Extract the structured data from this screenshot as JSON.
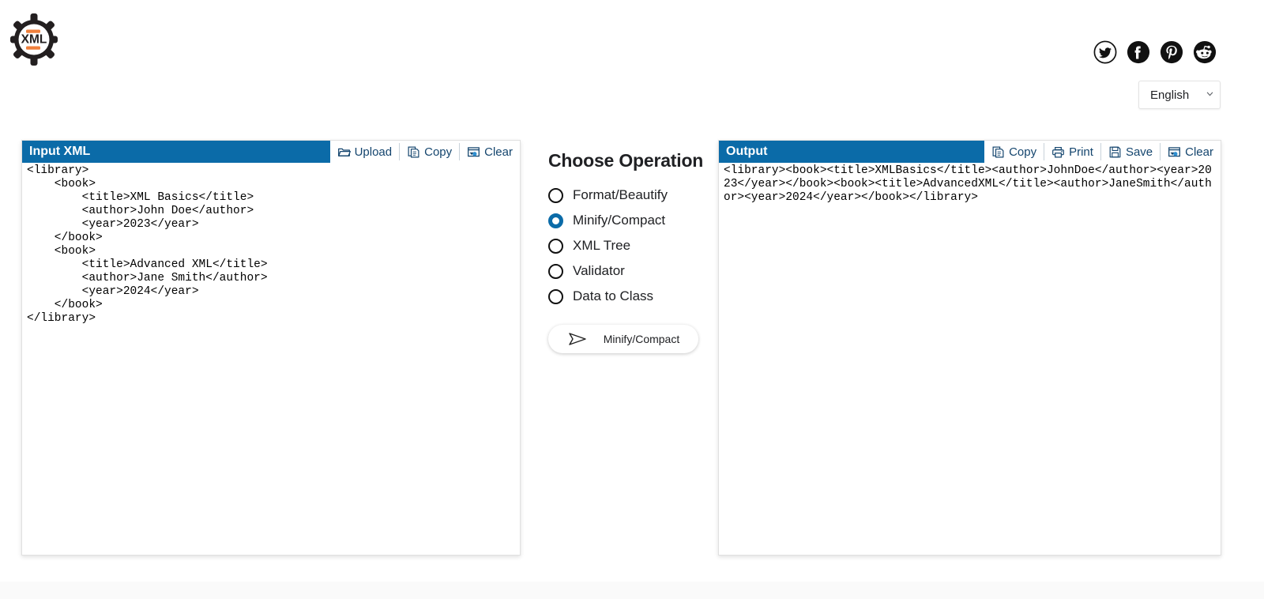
{
  "header": {
    "logo_text": "XML",
    "social": [
      {
        "name": "twitter-icon",
        "label": "Twitter"
      },
      {
        "name": "facebook-icon",
        "label": "Facebook"
      },
      {
        "name": "pinterest-icon",
        "label": "Pinterest"
      },
      {
        "name": "reddit-icon",
        "label": "Reddit"
      }
    ],
    "language": {
      "selected": "English",
      "options": [
        "English"
      ]
    }
  },
  "input_panel": {
    "title": "Input XML",
    "tools": [
      {
        "label": "Upload",
        "icon": "folder-icon"
      },
      {
        "label": "Copy",
        "icon": "copy-icon"
      },
      {
        "label": "Clear",
        "icon": "clear-icon"
      }
    ],
    "value": "<library>\n    <book>\n        <title>XML Basics</title>\n        <author>John Doe</author>\n        <year>2023</year>\n    </book>\n    <book>\n        <title>Advanced XML</title>\n        <author>Jane Smith</author>\n        <year>2024</year>\n    </book>\n</library>",
    "placeholder": ""
  },
  "output_panel": {
    "title": "Output",
    "tools": [
      {
        "label": "Copy",
        "icon": "copy-icon"
      },
      {
        "label": "Print",
        "icon": "print-icon"
      },
      {
        "label": "Save",
        "icon": "save-icon"
      },
      {
        "label": "Clear",
        "icon": "clear-icon"
      }
    ],
    "value": "<library><book><title>XMLBasics</title><author>JohnDoe</author><year>2023</year></book><book><title>AdvancedXML</title><author>JaneSmith</author><year>2024</year></book></library>",
    "placeholder": ""
  },
  "operations": {
    "title": "Choose Operation",
    "items": [
      {
        "label": "Format/Beautify",
        "selected": false
      },
      {
        "label": "Minify/Compact",
        "selected": true
      },
      {
        "label": "XML Tree",
        "selected": false
      },
      {
        "label": "Validator",
        "selected": false
      },
      {
        "label": "Data to Class",
        "selected": false
      }
    ],
    "run_button": {
      "label": "Minify/Compact",
      "icon": "send-icon"
    }
  },
  "colors": {
    "panel_header_blue": "#0b6ba8",
    "tool_text_blue": "#14456e",
    "radio_selected": "#0b6ba8",
    "logo_accent_orange": "#f0803c",
    "logo_dark": "#231f20"
  }
}
